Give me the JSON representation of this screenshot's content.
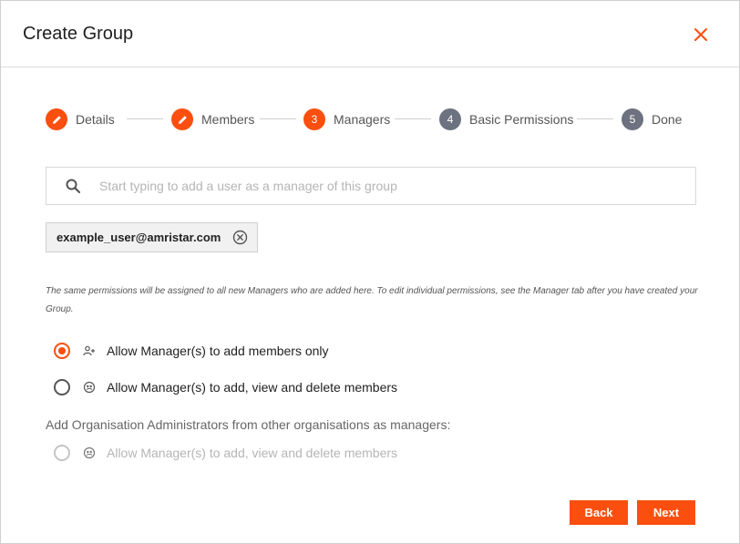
{
  "dialog": {
    "title": "Create Group",
    "steps": [
      {
        "label": "Details",
        "number": "",
        "state": "done"
      },
      {
        "label": "Members",
        "number": "",
        "state": "done"
      },
      {
        "label": "Managers",
        "number": "3",
        "state": "current"
      },
      {
        "label": "Basic Permissions",
        "number": "4",
        "state": "upcoming"
      },
      {
        "label": "Done",
        "number": "5",
        "state": "upcoming"
      }
    ],
    "search": {
      "value": "",
      "placeholder": "Start typing to add a user as a manager of this group"
    },
    "chip": {
      "label": "example_user@amristar.com"
    },
    "info_text": "The same permissions will be assigned to all new Managers who are added here. To edit individual permissions, see the Manager tab after you have created your Group.",
    "options": [
      {
        "label": "Allow Manager(s) to add members only",
        "checked": true,
        "disabled": false
      },
      {
        "label": "Allow Manager(s) to add, view and delete members",
        "checked": false,
        "disabled": false
      }
    ],
    "org_admins_label": "Add Organisation Administrators from other organisations as managers:",
    "org_admin_option": {
      "label": "Allow Manager(s) to add, view and delete members",
      "checked": false,
      "disabled": true
    },
    "buttons": {
      "back": "Back",
      "next": "Next"
    }
  },
  "colors": {
    "accent": "#fa4f0f",
    "step_upcoming": "#6d7280",
    "disabled": "#b5b5b5"
  },
  "icons": {
    "close": "close-icon",
    "step_done": "pencil-icon",
    "search": "search-icon",
    "chip_remove": "remove-circle-icon",
    "option_add": "add-user-icon",
    "option_manage": "manage-users-icon"
  }
}
